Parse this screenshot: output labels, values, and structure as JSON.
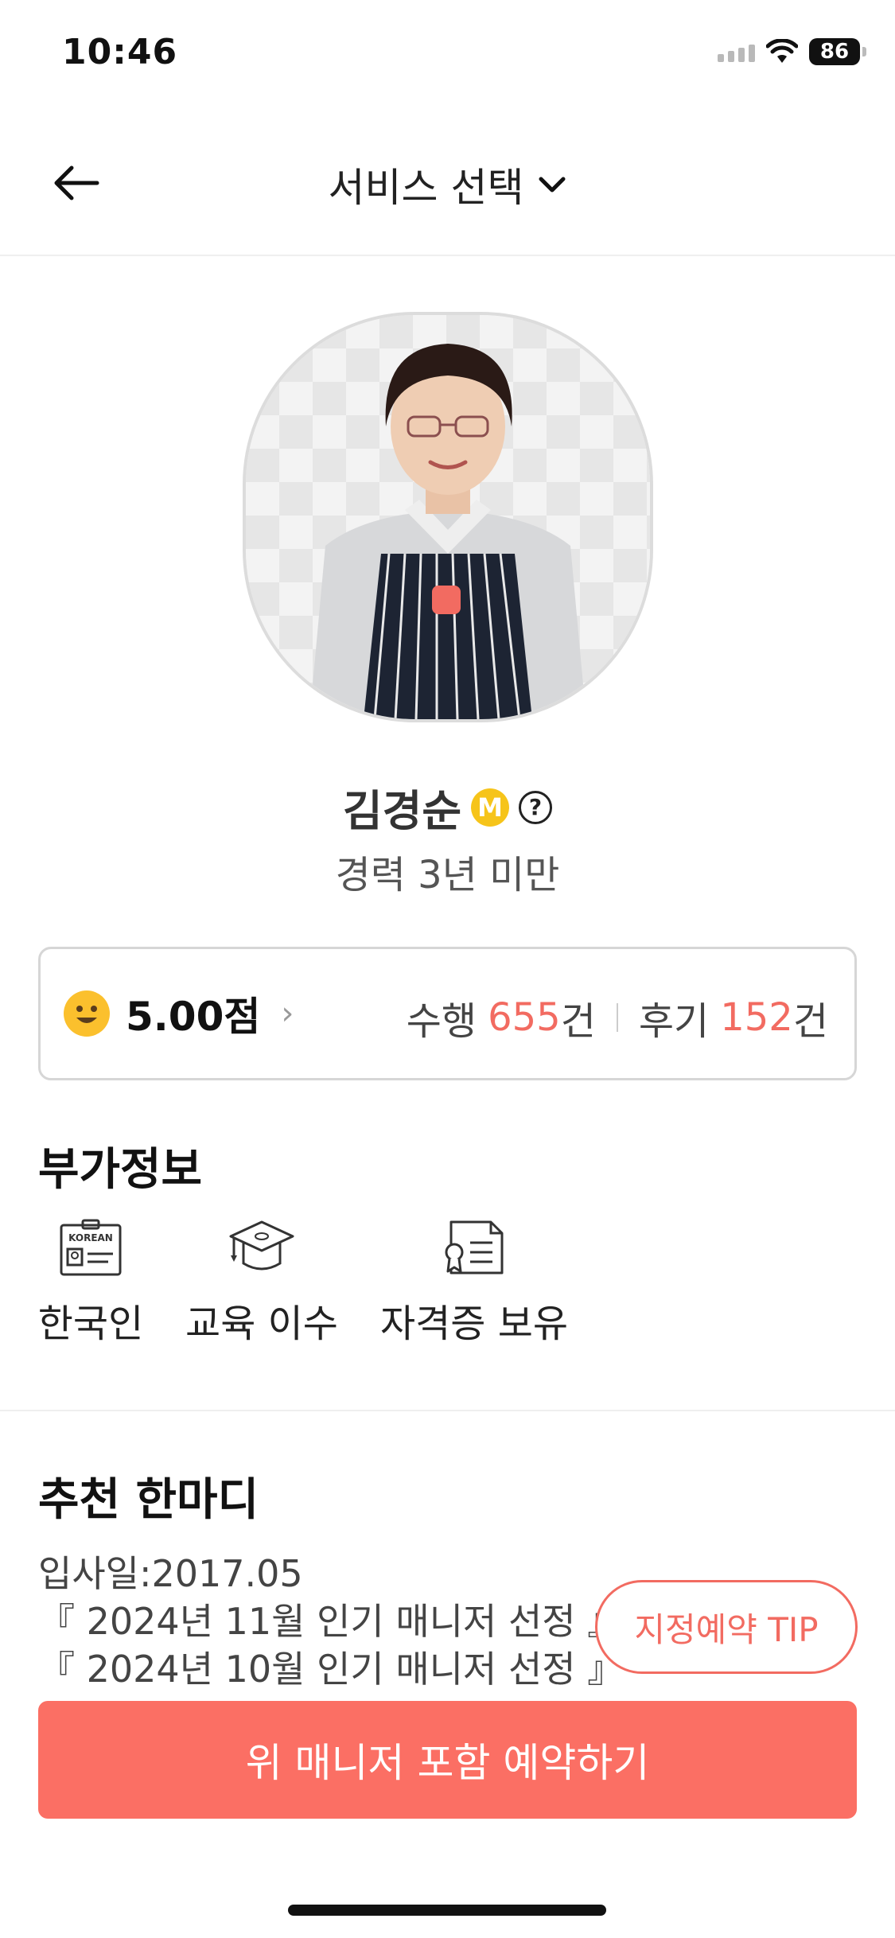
{
  "status_bar": {
    "time": "10:46",
    "battery": "86"
  },
  "header": {
    "title": "서비스 선택"
  },
  "profile": {
    "name": "김경순",
    "badge": "M",
    "help": "?",
    "career": "경력 3년 미만"
  },
  "stats": {
    "score": "5.00점",
    "jobs_label": "수행",
    "jobs_count": "655",
    "jobs_unit": "건",
    "reviews_label": "후기",
    "reviews_count": "152",
    "reviews_unit": "건"
  },
  "extra_info": {
    "title": "부가정보",
    "items": [
      {
        "label": "한국인",
        "icon": "korean-id-card-icon",
        "icon_text": "KOREAN"
      },
      {
        "label": "교육 이수",
        "icon": "graduation-cap-icon"
      },
      {
        "label": "자격증 보유",
        "icon": "certificate-icon"
      }
    ]
  },
  "recommend": {
    "title": "추천 한마디",
    "lines": [
      "입사일:2017.05",
      "『 2024년 11월 인기 매니저 선정 』",
      "『 2024년 10월 인기 매니저 선정 』"
    ]
  },
  "tip_button": "지정예약 TIP",
  "cta_button": "위 매니저 포함 예약하기",
  "colors": {
    "accent": "#fb6f64",
    "badge": "#f6c41a"
  }
}
